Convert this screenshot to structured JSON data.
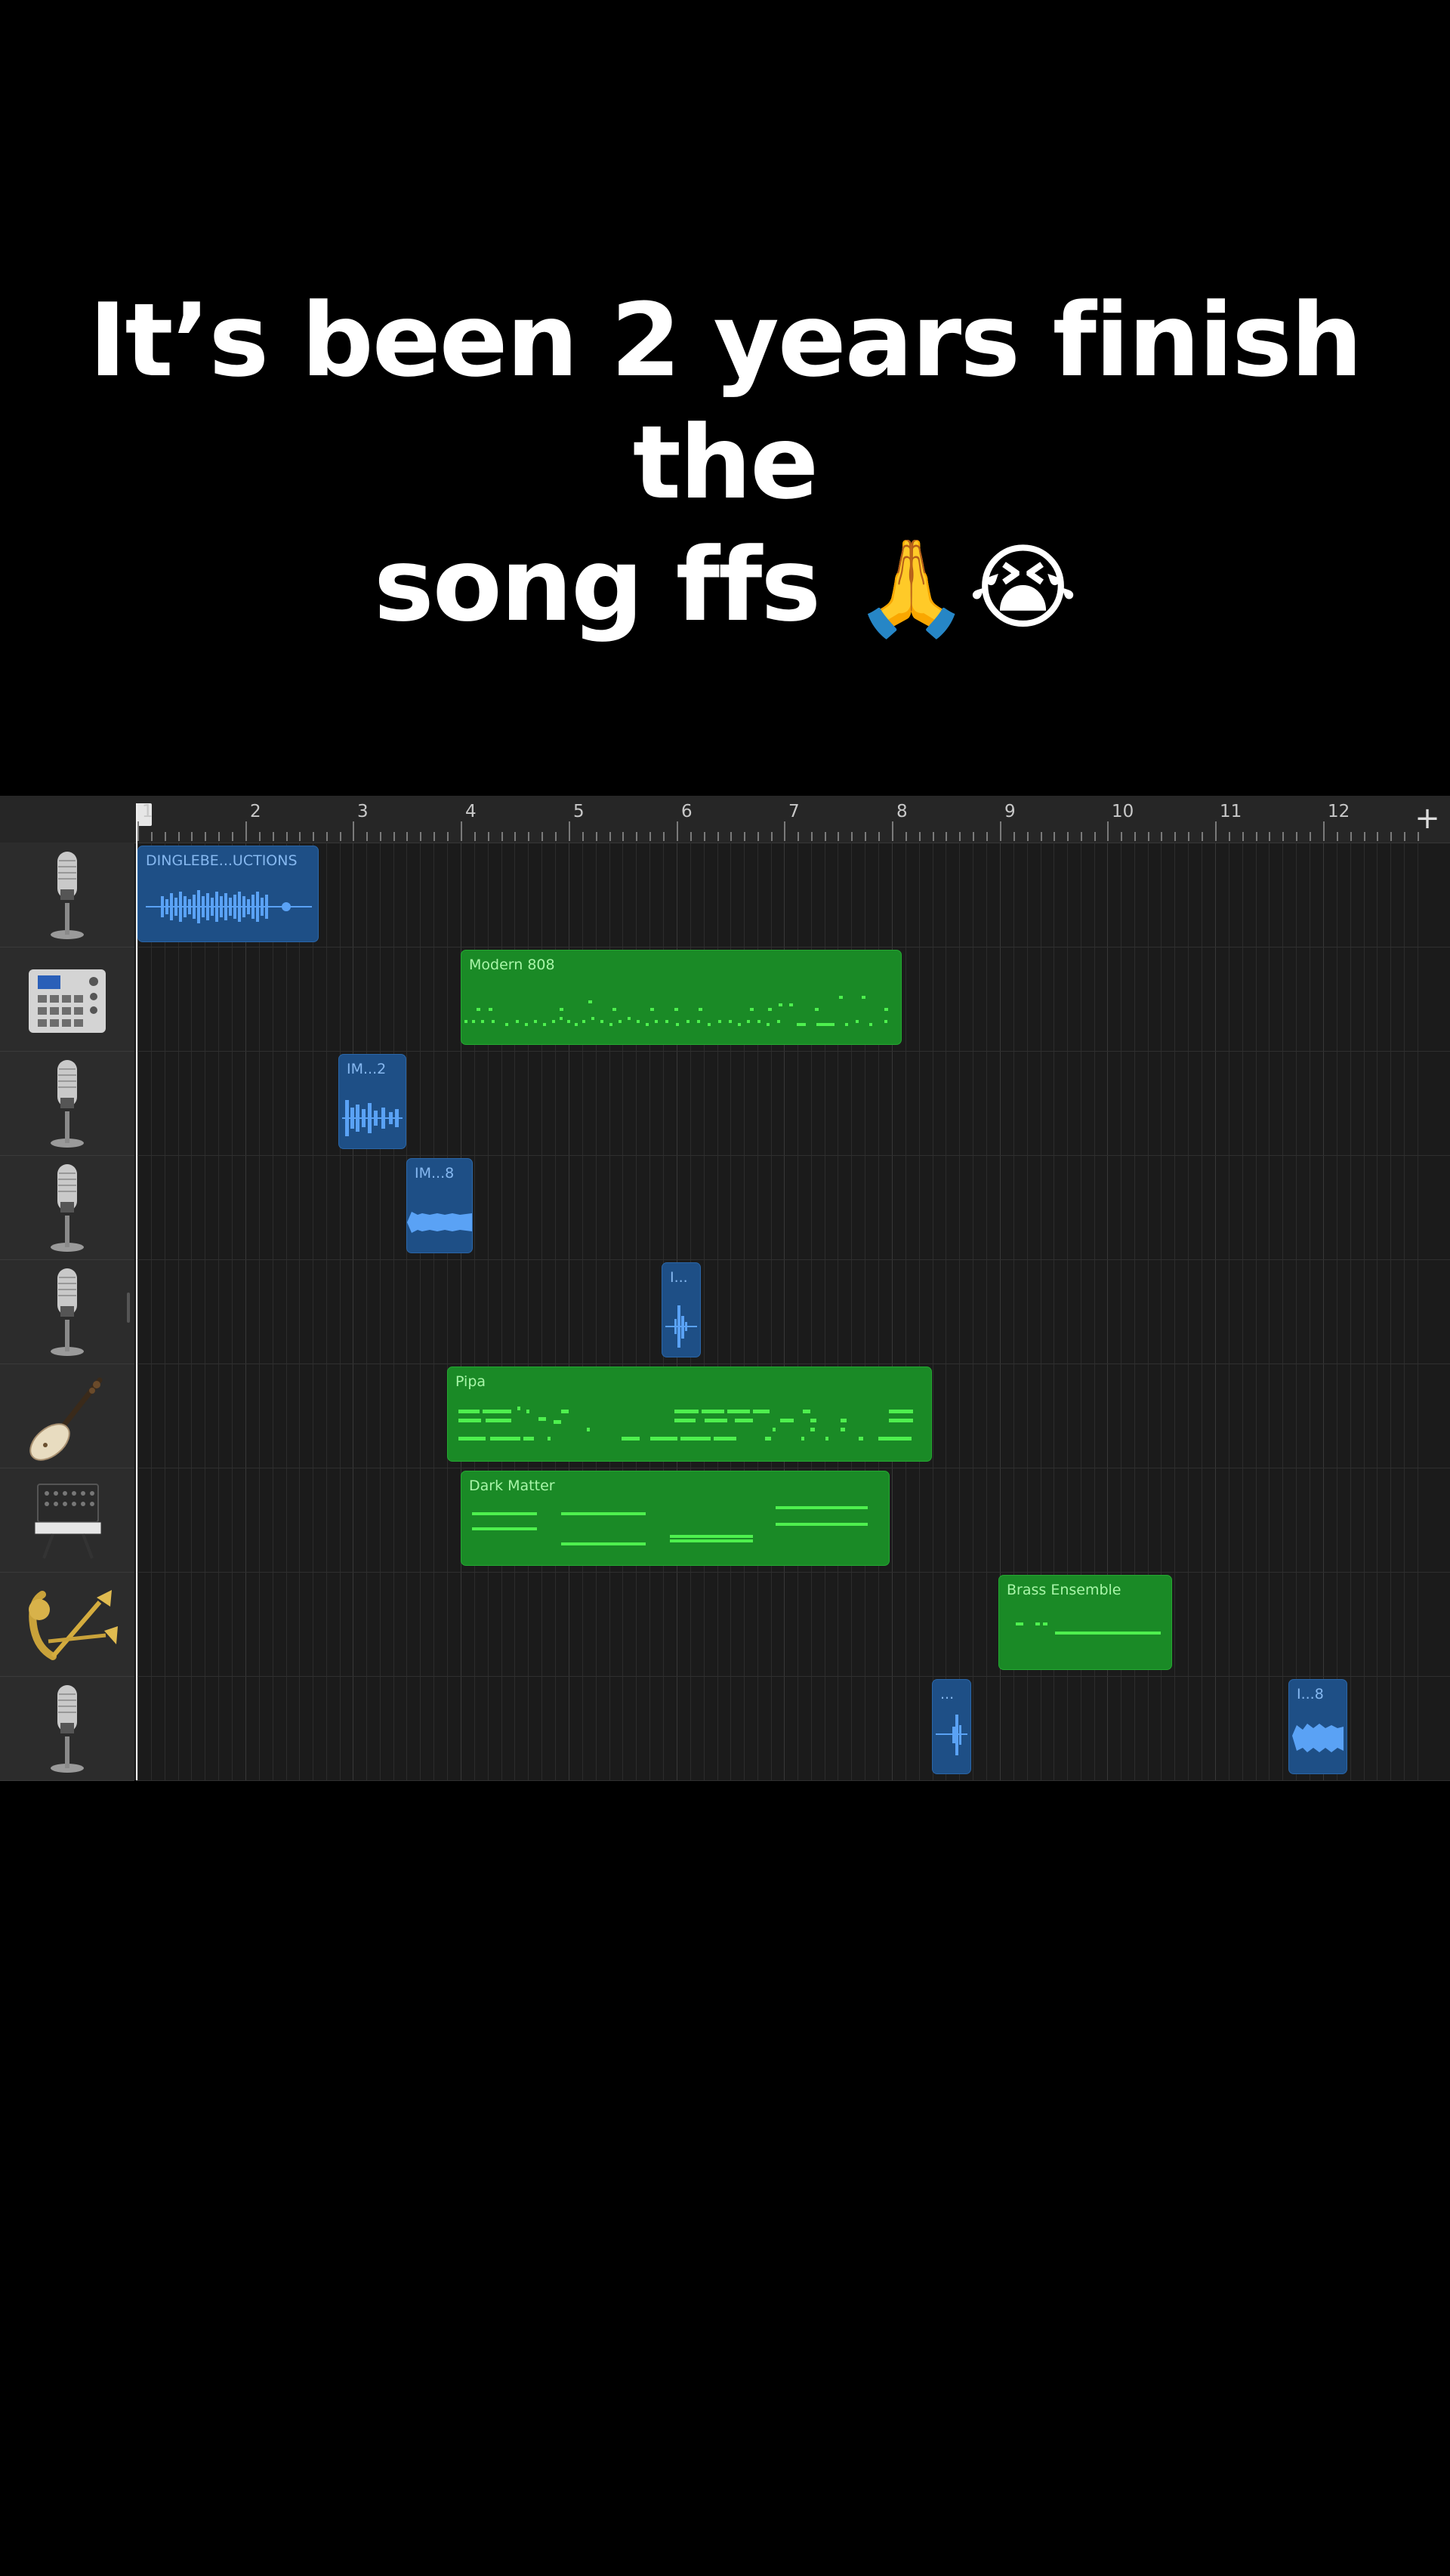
{
  "caption": {
    "line1": "It’s been 2 years finish the",
    "line2_text": "song ffs",
    "line2_emoji": "🙏😭"
  },
  "timeline": {
    "bars": [
      "1",
      "2",
      "3",
      "4",
      "5",
      "6",
      "7",
      "8",
      "9",
      "10",
      "11",
      "12"
    ],
    "add_track_label": "+"
  },
  "tracks": [
    {
      "icon": "microphone-icon"
    },
    {
      "icon": "drum-machine-icon"
    },
    {
      "icon": "microphone-icon"
    },
    {
      "icon": "microphone-icon"
    },
    {
      "icon": "microphone-icon"
    },
    {
      "icon": "pipa-icon"
    },
    {
      "icon": "synthesizer-icon"
    },
    {
      "icon": "brass-instruments-icon"
    },
    {
      "icon": "microphone-icon"
    }
  ],
  "regions": [
    {
      "label": "DINGLEBE...UCTIONS",
      "type": "audio",
      "track": 1
    },
    {
      "label": "Modern 808",
      "type": "midi",
      "track": 2
    },
    {
      "label": "IM...2",
      "type": "audio",
      "track": 3
    },
    {
      "label": "IM...8",
      "type": "audio",
      "track": 4
    },
    {
      "label": "I...",
      "type": "audio",
      "track": 5
    },
    {
      "label": "Pipa",
      "type": "midi",
      "track": 6
    },
    {
      "label": "Dark Matter",
      "type": "midi",
      "track": 7
    },
    {
      "label": "Brass Ensemble",
      "type": "midi",
      "track": 8
    },
    {
      "label": "...",
      "type": "audio",
      "track": 9
    },
    {
      "label": "I...8",
      "type": "audio",
      "track": 9
    }
  ],
  "colors": {
    "audio_region": "#1e4f86",
    "midi_region": "#1a8a26",
    "midi_note": "#4ef04e",
    "waveform": "#5aa2f5"
  }
}
